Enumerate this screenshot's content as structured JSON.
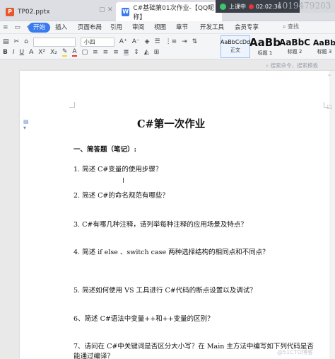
{
  "tabs": [
    {
      "label": "TP02.pptx",
      "icon": "P"
    },
    {
      "label": "C#基础第01次作业-【QQ昵称】",
      "icon": "W"
    }
  ],
  "meeting": {
    "status": "上课中",
    "time": "02:02:36"
  },
  "watermark_id": "1019479203",
  "menu": {
    "items": [
      "开始",
      "插入",
      "页面布局",
      "引用",
      "审阅",
      "视图",
      "章节",
      "开发工具",
      "会员专享"
    ],
    "search": "查找"
  },
  "ribbon": {
    "font_size": "小四",
    "styles": [
      {
        "sample": "AaBbCcDd",
        "name": "正文"
      },
      {
        "sample": "AaBb",
        "name": "标题 1"
      },
      {
        "sample": "AaBbC",
        "name": "标题 2"
      },
      {
        "sample": "AaBb",
        "name": "标题 3"
      }
    ]
  },
  "subbar": {
    "search_hint": "搜索命令，搜索模板"
  },
  "document": {
    "title": "C#第一次作业",
    "section": "一、简答题（笔记）:",
    "questions": [
      "1. 简述 C#变量的使用步骤？",
      "2. 简述 C#的命名规范有哪些？",
      "3. C#有哪几种注释，请列举每种注释的应用场景及特点？",
      "4. 简述 if else 、switch case 两种选择结构的相同点和不同点？",
      "5. 简述如何使用 VS 工具进行 C#代码的断点设置以及调试？",
      "6、简述 C#语法中变量++和++变量的区别？",
      "7、请问在 C#中关键词是否区分大小写？在 Main 主方法中编写如下列代码是否",
      "能通过编译？"
    ]
  },
  "bottom_watermark": "@51CTO博客",
  "colors": {
    "accent": "#3a7bf0",
    "highlight": "#fff6cc"
  },
  "icons": [
    "close-icon",
    "add-tab-icon",
    "undo-icon",
    "bold-icon",
    "italic-icon",
    "underline-icon",
    "align-center-icon",
    "comment-icon"
  ]
}
